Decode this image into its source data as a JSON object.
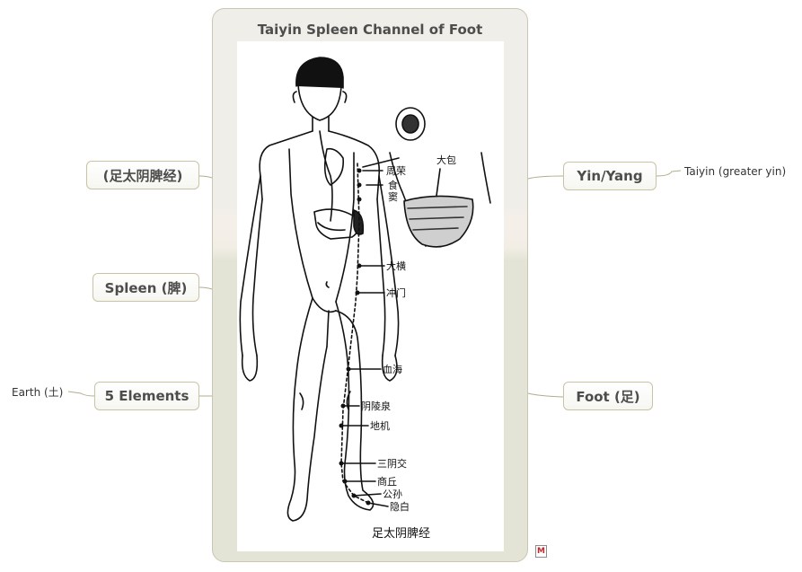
{
  "central": {
    "title": "Taiyin Spleen Channel of Foot",
    "caption": "足太阴脾经",
    "points": {
      "zhourong": "周荣",
      "shidou": "食\n窦",
      "dabao": "大包",
      "daheng": "大横",
      "chongmen": "冲门",
      "xuehai": "血海",
      "yinlingquan": "阴陵泉",
      "diji": "地机",
      "sanyinjiao": "三阴交",
      "shangqiu": "商丘",
      "gongsun": "公孙",
      "yinbai": "隐白"
    }
  },
  "left_topics": [
    {
      "label": "(足太阴脾经)"
    },
    {
      "label": "Spleen (脾)"
    },
    {
      "label": "5 Elements",
      "subtopic": "Earth (土)"
    }
  ],
  "right_topics": [
    {
      "label": "Yin/Yang",
      "subtopic": "Taiyin (greater yin)"
    },
    {
      "label": "Foot (足)"
    }
  ],
  "colors": {
    "topic_border": "#c9c3a4",
    "connector": "#b3ad8c",
    "title_text": "#4d4d4d"
  },
  "icons": [
    "mindmap-note-icon"
  ]
}
